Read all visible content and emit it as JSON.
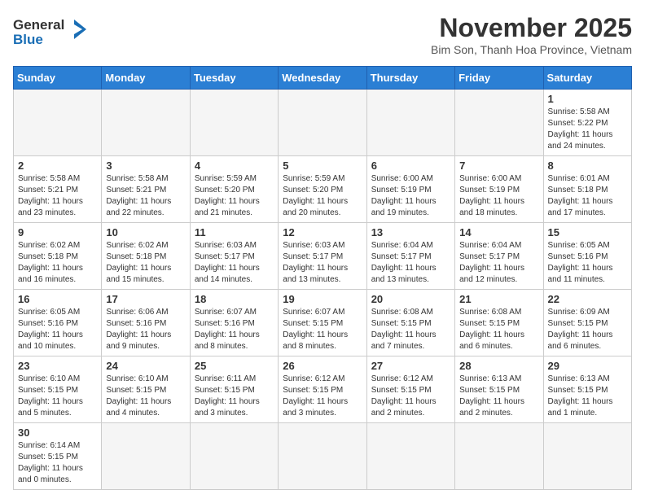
{
  "header": {
    "logo_general": "General",
    "logo_blue": "Blue",
    "month_title": "November 2025",
    "subtitle": "Bim Son, Thanh Hoa Province, Vietnam"
  },
  "weekdays": [
    "Sunday",
    "Monday",
    "Tuesday",
    "Wednesday",
    "Thursday",
    "Friday",
    "Saturday"
  ],
  "days": {
    "d1": {
      "num": "1",
      "sunrise": "5:58 AM",
      "sunset": "5:22 PM",
      "daylight": "11 hours and 24 minutes."
    },
    "d2": {
      "num": "2",
      "sunrise": "5:58 AM",
      "sunset": "5:21 PM",
      "daylight": "11 hours and 23 minutes."
    },
    "d3": {
      "num": "3",
      "sunrise": "5:58 AM",
      "sunset": "5:21 PM",
      "daylight": "11 hours and 22 minutes."
    },
    "d4": {
      "num": "4",
      "sunrise": "5:59 AM",
      "sunset": "5:20 PM",
      "daylight": "11 hours and 21 minutes."
    },
    "d5": {
      "num": "5",
      "sunrise": "5:59 AM",
      "sunset": "5:20 PM",
      "daylight": "11 hours and 20 minutes."
    },
    "d6": {
      "num": "6",
      "sunrise": "6:00 AM",
      "sunset": "5:19 PM",
      "daylight": "11 hours and 19 minutes."
    },
    "d7": {
      "num": "7",
      "sunrise": "6:00 AM",
      "sunset": "5:19 PM",
      "daylight": "11 hours and 18 minutes."
    },
    "d8": {
      "num": "8",
      "sunrise": "6:01 AM",
      "sunset": "5:18 PM",
      "daylight": "11 hours and 17 minutes."
    },
    "d9": {
      "num": "9",
      "sunrise": "6:02 AM",
      "sunset": "5:18 PM",
      "daylight": "11 hours and 16 minutes."
    },
    "d10": {
      "num": "10",
      "sunrise": "6:02 AM",
      "sunset": "5:18 PM",
      "daylight": "11 hours and 15 minutes."
    },
    "d11": {
      "num": "11",
      "sunrise": "6:03 AM",
      "sunset": "5:17 PM",
      "daylight": "11 hours and 14 minutes."
    },
    "d12": {
      "num": "12",
      "sunrise": "6:03 AM",
      "sunset": "5:17 PM",
      "daylight": "11 hours and 13 minutes."
    },
    "d13": {
      "num": "13",
      "sunrise": "6:04 AM",
      "sunset": "5:17 PM",
      "daylight": "11 hours and 13 minutes."
    },
    "d14": {
      "num": "14",
      "sunrise": "6:04 AM",
      "sunset": "5:17 PM",
      "daylight": "11 hours and 12 minutes."
    },
    "d15": {
      "num": "15",
      "sunrise": "6:05 AM",
      "sunset": "5:16 PM",
      "daylight": "11 hours and 11 minutes."
    },
    "d16": {
      "num": "16",
      "sunrise": "6:05 AM",
      "sunset": "5:16 PM",
      "daylight": "11 hours and 10 minutes."
    },
    "d17": {
      "num": "17",
      "sunrise": "6:06 AM",
      "sunset": "5:16 PM",
      "daylight": "11 hours and 9 minutes."
    },
    "d18": {
      "num": "18",
      "sunrise": "6:07 AM",
      "sunset": "5:16 PM",
      "daylight": "11 hours and 8 minutes."
    },
    "d19": {
      "num": "19",
      "sunrise": "6:07 AM",
      "sunset": "5:15 PM",
      "daylight": "11 hours and 8 minutes."
    },
    "d20": {
      "num": "20",
      "sunrise": "6:08 AM",
      "sunset": "5:15 PM",
      "daylight": "11 hours and 7 minutes."
    },
    "d21": {
      "num": "21",
      "sunrise": "6:08 AM",
      "sunset": "5:15 PM",
      "daylight": "11 hours and 6 minutes."
    },
    "d22": {
      "num": "22",
      "sunrise": "6:09 AM",
      "sunset": "5:15 PM",
      "daylight": "11 hours and 6 minutes."
    },
    "d23": {
      "num": "23",
      "sunrise": "6:10 AM",
      "sunset": "5:15 PM",
      "daylight": "11 hours and 5 minutes."
    },
    "d24": {
      "num": "24",
      "sunrise": "6:10 AM",
      "sunset": "5:15 PM",
      "daylight": "11 hours and 4 minutes."
    },
    "d25": {
      "num": "25",
      "sunrise": "6:11 AM",
      "sunset": "5:15 PM",
      "daylight": "11 hours and 3 minutes."
    },
    "d26": {
      "num": "26",
      "sunrise": "6:12 AM",
      "sunset": "5:15 PM",
      "daylight": "11 hours and 3 minutes."
    },
    "d27": {
      "num": "27",
      "sunrise": "6:12 AM",
      "sunset": "5:15 PM",
      "daylight": "11 hours and 2 minutes."
    },
    "d28": {
      "num": "28",
      "sunrise": "6:13 AM",
      "sunset": "5:15 PM",
      "daylight": "11 hours and 2 minutes."
    },
    "d29": {
      "num": "29",
      "sunrise": "6:13 AM",
      "sunset": "5:15 PM",
      "daylight": "11 hours and 1 minute."
    },
    "d30": {
      "num": "30",
      "sunrise": "6:14 AM",
      "sunset": "5:15 PM",
      "daylight": "11 hours and 0 minutes."
    }
  },
  "labels": {
    "sunrise": "Sunrise:",
    "sunset": "Sunset:",
    "daylight": "Daylight:"
  }
}
